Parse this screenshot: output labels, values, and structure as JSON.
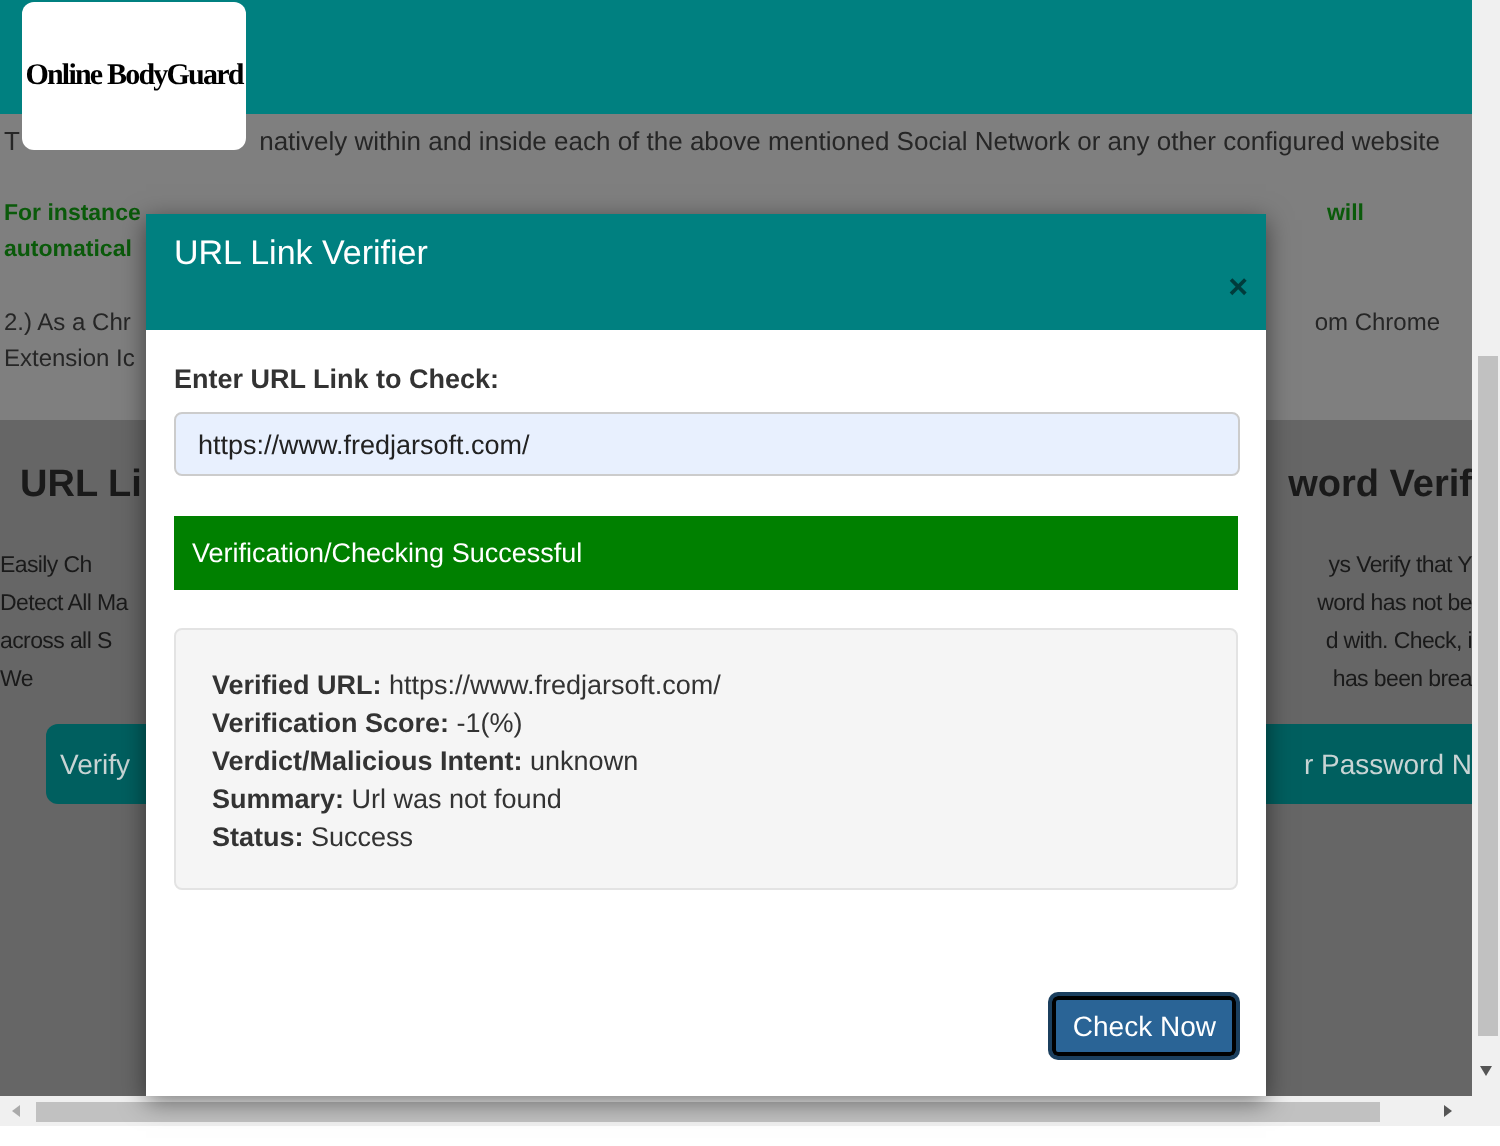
{
  "header": {
    "logo": "Online BodyGuard"
  },
  "background": {
    "top_lines": [
      {
        "kind": "text",
        "left": "T",
        "right": "natively within and inside each of the above mentioned Social Network or any other configured website"
      },
      {
        "kind": "emphasis",
        "left": "For instance",
        "right": "will"
      },
      {
        "kind": "emphasis",
        "left": "automatical"
      },
      {
        "kind": "text",
        "left": "2.) As a Chr",
        "right": "om Chrome"
      },
      {
        "kind": "text",
        "left": "Extension Ic"
      }
    ],
    "section_headings": {
      "left": "URL Li",
      "right": "word Verif"
    },
    "section_lines": [
      {
        "left": "Easily Ch",
        "right": "ys Verify that Y"
      },
      {
        "left": "Detect All Ma",
        "right": "word has not be"
      },
      {
        "left": "across all S",
        "right": "d with. Check, i"
      },
      {
        "left": "We",
        "right": "has been brea"
      }
    ],
    "buttons": {
      "left": "Verify",
      "right": "r Password N"
    }
  },
  "modal": {
    "title": "URL Link Verifier",
    "close": "×",
    "field_label": "Enter URL Link to Check:",
    "field_value": "https://www.fredjarsoft.com/",
    "alert": "Verification/Checking Successful",
    "results": [
      {
        "label": "Verified URL:",
        "value": "https://www.fredjarsoft.com/"
      },
      {
        "label": "Verification Score:",
        "value": "-1(%)"
      },
      {
        "label": "Verdict/Malicious Intent:",
        "value": "unknown"
      },
      {
        "label": "Summary:",
        "value": "Url was not found"
      },
      {
        "label": "Status:",
        "value": "Success"
      }
    ],
    "button": "Check Now"
  }
}
